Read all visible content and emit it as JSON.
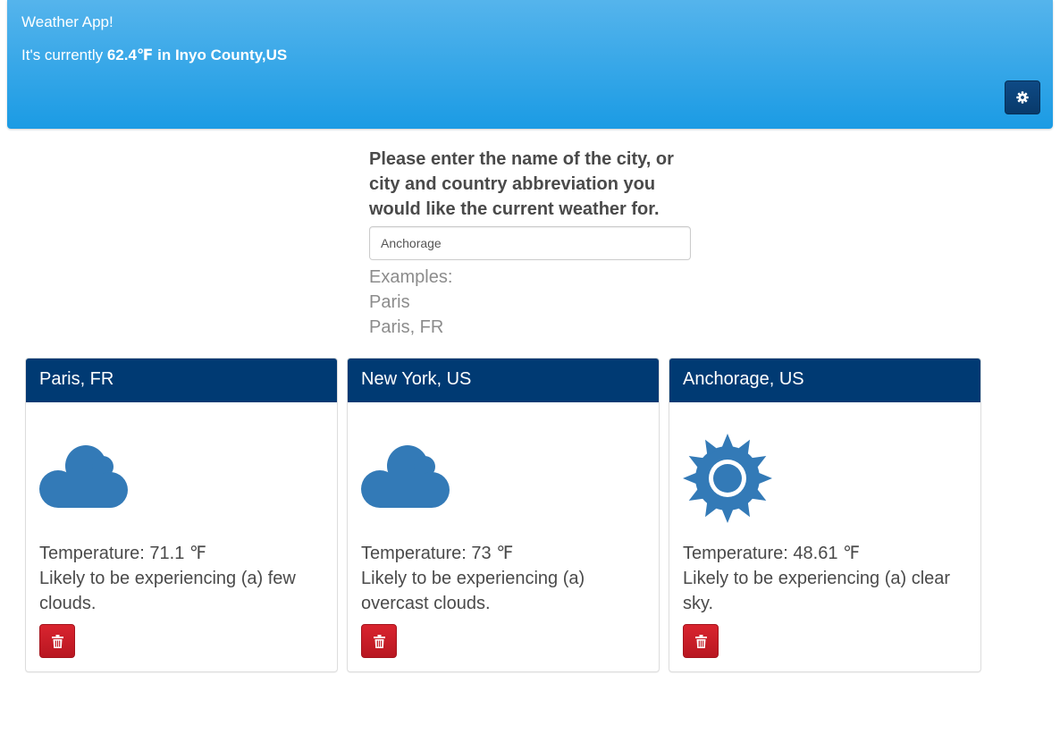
{
  "header": {
    "title": "Weather App!",
    "current_prefix": "It's currently ",
    "current_temp": "62.4℉",
    "current_in": " in ",
    "current_location": "Inyo County,US",
    "settings_icon": "gear-icon"
  },
  "search": {
    "prompt": "Please enter the name of the city, or city and country abbreviation you would like the current weather for.",
    "value": "Anchorage",
    "examples_heading": "Examples:",
    "examples": [
      "Paris",
      "Paris, FR"
    ]
  },
  "cards": [
    {
      "city": "Paris, FR",
      "icon": "cloud-icon",
      "temperature_label": "Temperature: 71.1 ℉",
      "description": "Likely to be experiencing (a) few clouds."
    },
    {
      "city": "New York, US",
      "icon": "cloud-icon",
      "temperature_label": "Temperature: 73 ℉",
      "description": "Likely to be experiencing (a) overcast clouds."
    },
    {
      "city": "Anchorage, US",
      "icon": "sun-icon",
      "temperature_label": "Temperature: 48.61 ℉",
      "description": "Likely to be experiencing (a) clear sky."
    }
  ],
  "colors": {
    "header_gradient_top": "#55b4ec",
    "header_gradient_bottom": "#1b9be4",
    "card_header": "#003a73",
    "icon_blue": "#337ab7",
    "delete_red": "#c9202a"
  }
}
